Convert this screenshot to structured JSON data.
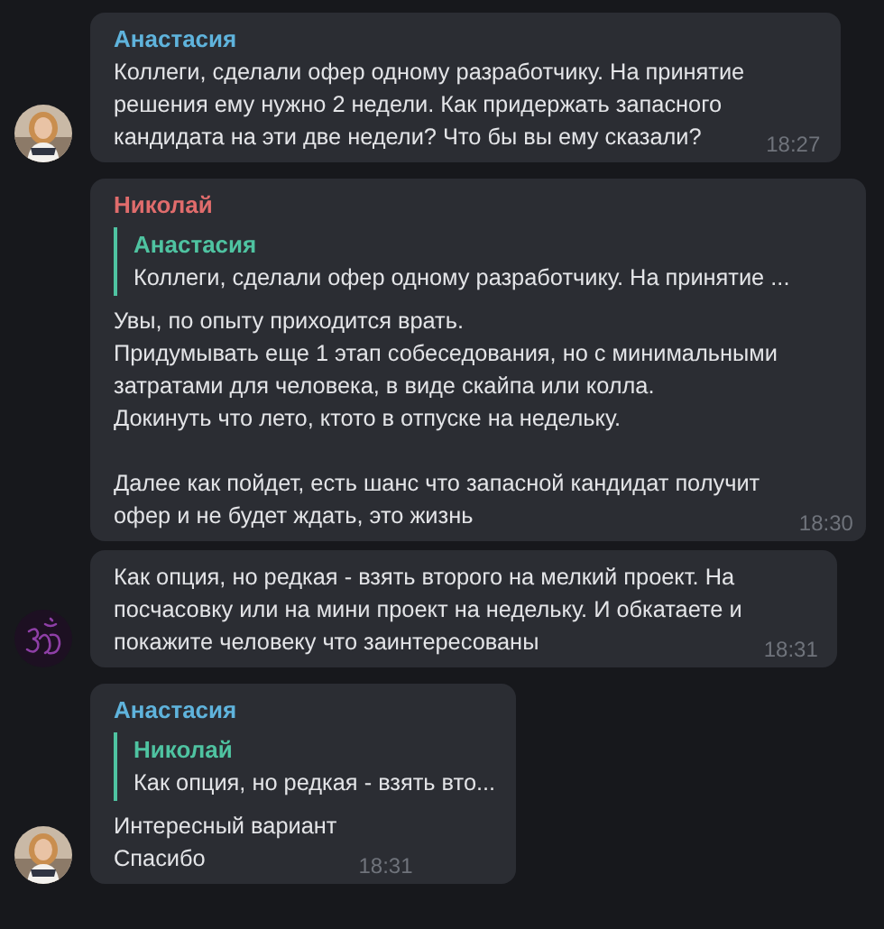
{
  "messages": [
    {
      "author": "Анастасия",
      "color": "#5fb3dc",
      "text": "Коллеги, сделали офер одному разработчику. На принятие\nрешения ему нужно 2 недели. Как придержать запасного\nкандидата на эти две недели? Что бы вы ему сказали?",
      "time": "18:27"
    },
    {
      "author": "Николай",
      "color": "#e06c6c",
      "reply": {
        "author": "Анастасия",
        "text": "Коллеги, сделали офер одному разработчику. На принятие ..."
      },
      "text": "Увы, по опыту приходится врать.\nПридумывать еще 1 этап собеседования, но с минимальными\nзатратами для человека, в виде скайпа или колла.\nДокинуть что лето, ктото в отпуске на недельку.\n\nДалее как пойдет, есть шанс что запасной кандидат получит\nофер и не будет ждать, это жизнь",
      "time": "18:30"
    },
    {
      "text": "Как опция, но редкая - взять второго на мелкий проект. На\nпосчасовку или на мини проект на недельку. И обкатаете и\nпокажите человеку что заинтересованы",
      "time": "18:31",
      "avatar": {
        "kind": "emblem"
      }
    },
    {
      "author": "Анастасия",
      "color": "#5fb3dc",
      "reply": {
        "author": "Николай",
        "text": "Как опция, но редкая - взять вто..."
      },
      "text": "Интересный вариант\nСпасибо",
      "time": "18:31"
    }
  ]
}
